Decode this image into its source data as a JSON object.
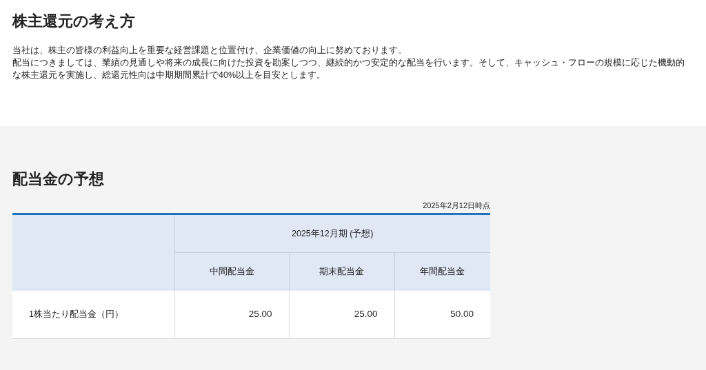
{
  "policy": {
    "title": "株主還元の考え方",
    "paragraphs": [
      "当社は、株主の皆様の利益向上を重要な経営課題と位置付け、企業価値の向上に努めております。",
      "配当につきましては、業績の見通しや将来の成長に向けた投資を勘案しつつ、継続的かつ安定的な配当を行います。そして、キャッシュ・フローの規模に応じた機動的な株主還元を実施し、総還元性向は中期期間累計で40%以上を目安とします。"
    ]
  },
  "forecast": {
    "title": "配当金の予想",
    "as_of": "2025年2月12日時点",
    "table": {
      "period": "2025年12月期 (予想)",
      "columns": [
        "中間配当金",
        "期末配当金",
        "年間配当金"
      ],
      "rows": [
        {
          "label": "1株当たり配当金（円）",
          "cells": [
            "25.00",
            "25.00",
            "50.00"
          ]
        }
      ]
    }
  }
}
